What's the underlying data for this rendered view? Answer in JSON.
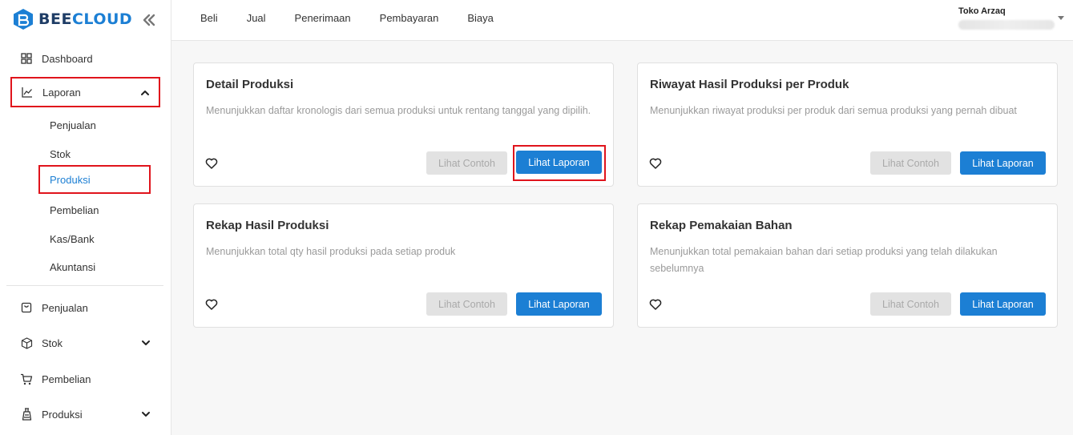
{
  "brand": {
    "name_part1": "BEE",
    "name_part2": "CLOUD",
    "primary_color": "#1c7fd4",
    "dark_color": "#1f3d66"
  },
  "sidebar": {
    "items": [
      {
        "label": "Dashboard",
        "icon": "grid-icon"
      },
      {
        "label": "Laporan",
        "icon": "chart-line-icon",
        "expanded": true
      },
      {
        "label": "Penjualan",
        "icon": "bag-icon"
      },
      {
        "label": "Stok",
        "icon": "box-icon"
      },
      {
        "label": "Pembelian",
        "icon": "cart-icon"
      },
      {
        "label": "Produksi",
        "icon": "factory-icon"
      }
    ],
    "laporan_sub": [
      {
        "label": "Penjualan"
      },
      {
        "label": "Stok"
      },
      {
        "label": "Produksi",
        "active": true
      },
      {
        "label": "Pembelian"
      },
      {
        "label": "Kas/Bank"
      },
      {
        "label": "Akuntansi"
      }
    ]
  },
  "topnav": [
    "Beli",
    "Jual",
    "Penerimaan",
    "Pembayaran",
    "Biaya"
  ],
  "store": {
    "name": "Toko Arzaq"
  },
  "cards": [
    {
      "title": "Detail Produksi",
      "desc": "Menunjukkan daftar kronologis dari semua produksi untuk rentang tanggal yang dipilih.",
      "btn_example": "Lihat Contoh",
      "btn_report": "Lihat Laporan"
    },
    {
      "title": "Riwayat Hasil Produksi per Produk",
      "desc": "Menunjukkan riwayat produksi per produk dari semua produksi yang pernah dibuat",
      "btn_example": "Lihat Contoh",
      "btn_report": "Lihat Laporan"
    },
    {
      "title": "Rekap Hasil Produksi",
      "desc": "Menunjukkan total qty hasil produksi pada setiap produk",
      "btn_example": "Lihat Contoh",
      "btn_report": "Lihat Laporan"
    },
    {
      "title": "Rekap Pemakaian Bahan",
      "desc": "Menunjukkan total pemakaian bahan dari setiap produksi yang telah dilakukan sebelumnya",
      "btn_example": "Lihat Contoh",
      "btn_report": "Lihat Laporan"
    }
  ],
  "highlight_color": "#e0141c"
}
